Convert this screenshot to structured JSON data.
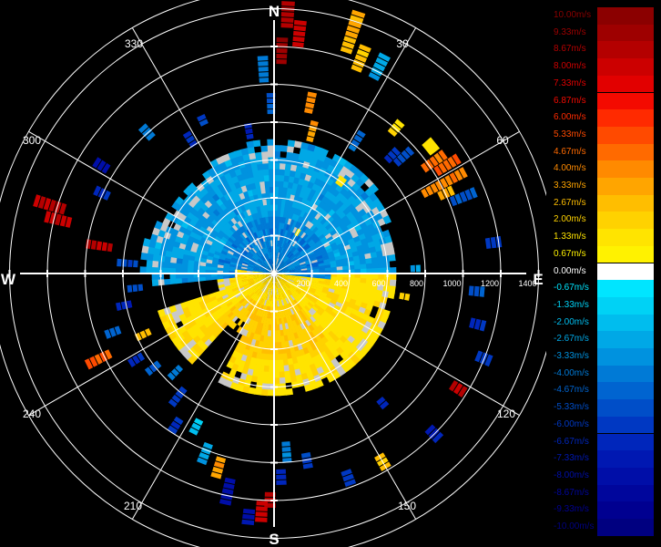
{
  "chart_data": {
    "type": "polar-ppi",
    "compass": {
      "north": "N",
      "east": "E",
      "south": "S",
      "west": "W"
    },
    "azimuth_labels": [
      "30",
      "60",
      "120",
      "150",
      "210",
      "240",
      "300",
      "330"
    ],
    "range_labels": [
      "200",
      "400",
      "600",
      "800",
      "1000",
      "1200",
      "1400"
    ],
    "range_max": 1500,
    "legend": [
      {
        "label": "10.00m/s",
        "color": "#8b0000"
      },
      {
        "label": "9.33m/s",
        "color": "#9e0000"
      },
      {
        "label": "8.67m/s",
        "color": "#b40000"
      },
      {
        "label": "8.00m/s",
        "color": "#cc0000"
      },
      {
        "label": "7.33m/s",
        "color": "#e20000"
      },
      {
        "label": "6.87m/s",
        "color": "#f40a00"
      },
      {
        "label": "6.00m/s",
        "color": "#ff2a00"
      },
      {
        "label": "5.33m/s",
        "color": "#ff4a00"
      },
      {
        "label": "4.67m/s",
        "color": "#ff6a00"
      },
      {
        "label": "4.00m/s",
        "color": "#ff8a00"
      },
      {
        "label": "3.33m/s",
        "color": "#ffa500"
      },
      {
        "label": "2.67m/s",
        "color": "#ffbe00"
      },
      {
        "label": "2.00m/s",
        "color": "#ffd200"
      },
      {
        "label": "1.33m/s",
        "color": "#ffe400"
      },
      {
        "label": "0.67m/s",
        "color": "#fff200"
      },
      {
        "label": "0.00m/s",
        "color": "#ffffff"
      },
      {
        "label": "-0.67m/s",
        "color": "#00e5ff"
      },
      {
        "label": "-1.33m/s",
        "color": "#00d2f5"
      },
      {
        "label": "-2.00m/s",
        "color": "#00bdee"
      },
      {
        "label": "-2.67m/s",
        "color": "#00a8e6"
      },
      {
        "label": "-3.33m/s",
        "color": "#0092df"
      },
      {
        "label": "-4.00m/s",
        "color": "#007ad6"
      },
      {
        "label": "-4.67m/s",
        "color": "#0064d0"
      },
      {
        "label": "-5.33m/s",
        "color": "#004ec8"
      },
      {
        "label": "-6.00m/s",
        "color": "#0038c2"
      },
      {
        "label": "-6.67m/s",
        "color": "#0026bb"
      },
      {
        "label": "-7.33m/s",
        "color": "#0018b2"
      },
      {
        "label": "-8.00m/s",
        "color": "#000ea8"
      },
      {
        "label": "-8.67m/s",
        "color": "#00069c"
      },
      {
        "label": "-9.33m/s",
        "color": "#000090"
      },
      {
        "label": "-10.00m/s",
        "color": "#000080"
      }
    ],
    "colors": {
      "background": "#000000",
      "grid": "#ffffff",
      "missing": "#c8c8c8"
    }
  }
}
